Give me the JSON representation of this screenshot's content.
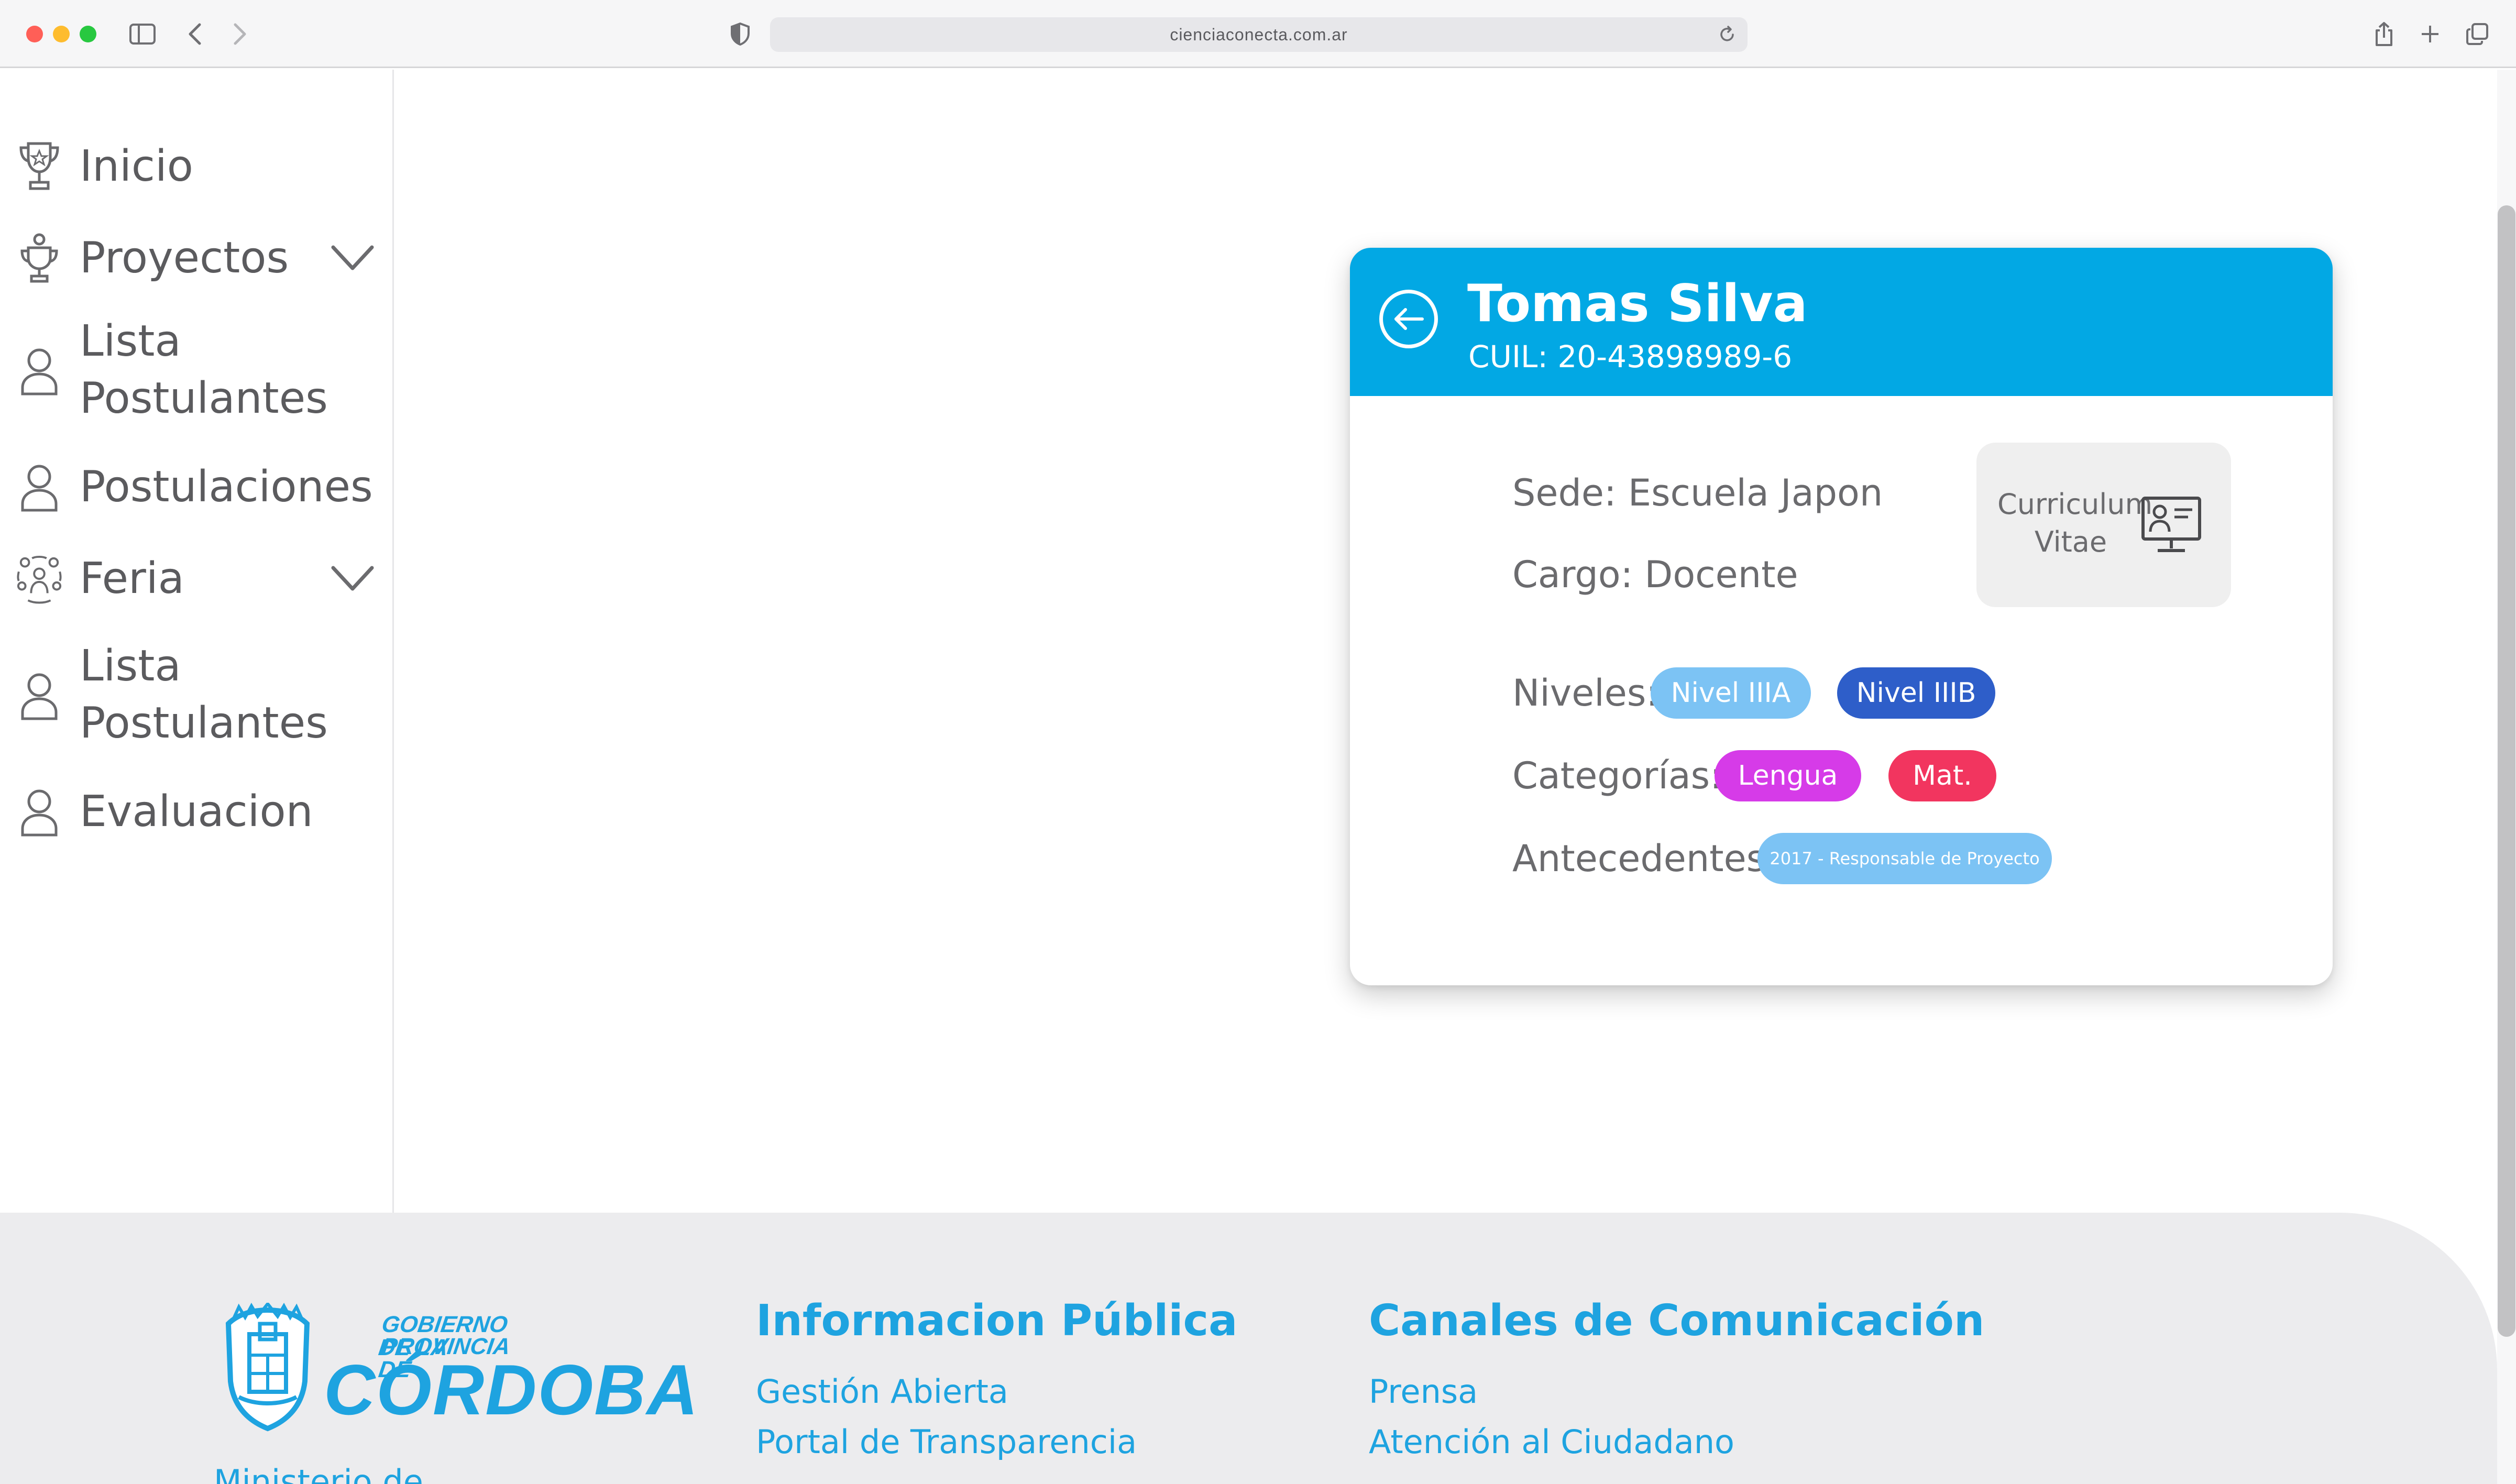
{
  "browser": {
    "url": "cienciaconecta.com.ar"
  },
  "sidebar": {
    "items": [
      {
        "label": "Inicio",
        "icon": "trophy-icon",
        "expandable": false
      },
      {
        "label": "Proyectos",
        "icon": "trophy-outline-icon",
        "expandable": true
      },
      {
        "label_line1": "Lista",
        "label_line2": "Postulantes",
        "icon": "user-icon",
        "expandable": false
      },
      {
        "label": "Postulaciones",
        "icon": "user-icon",
        "expandable": false
      },
      {
        "label": "Feria",
        "icon": "group-icon",
        "expandable": true
      },
      {
        "label_line1": "Lista",
        "label_line2": "Postulantes",
        "icon": "user-icon",
        "expandable": false
      },
      {
        "label": "Evaluacion",
        "icon": "user-icon",
        "expandable": false
      }
    ]
  },
  "profile": {
    "name": "Tomas Silva",
    "cuil": "CUIL: 20-43898989-6",
    "sede": "Sede: Escuela Japon",
    "cargo": "Cargo: Docente",
    "cv_line1": "Curriculum",
    "cv_line2": "Vitae",
    "niveles_label": "Niveles:",
    "niveles": [
      {
        "label": "Nivel IIIA",
        "color": "#7cc3f4"
      },
      {
        "label": "Nivel IIIB",
        "color": "#2e5ec9"
      }
    ],
    "categorias_label": "Categorías:",
    "categorias": [
      {
        "label": "Lengua",
        "color": "#d63be8"
      },
      {
        "label": "Mat.",
        "color": "#f2355f"
      }
    ],
    "antecedentes_label": "Antecedentes:",
    "antecedentes": [
      {
        "label": "2017 - Responsable de Proyecto",
        "color": "#7cc3f4"
      }
    ]
  },
  "footer": {
    "logo_line1": "GOBIERNO DE LA",
    "logo_line2": "PROVINCIA DE",
    "logo_main": "CÓRDOBA",
    "ministerio": "Ministerio de",
    "info_title": "Informacion Pública",
    "info_links": [
      "Gestión Abierta",
      "Portal de Transparencia"
    ],
    "canales_title": "Canales de Comunicación",
    "canales_links": [
      "Prensa",
      "Atención al Ciudadano"
    ]
  },
  "colors": {
    "accent": "#02a8e4",
    "link": "#1ea3e0"
  }
}
